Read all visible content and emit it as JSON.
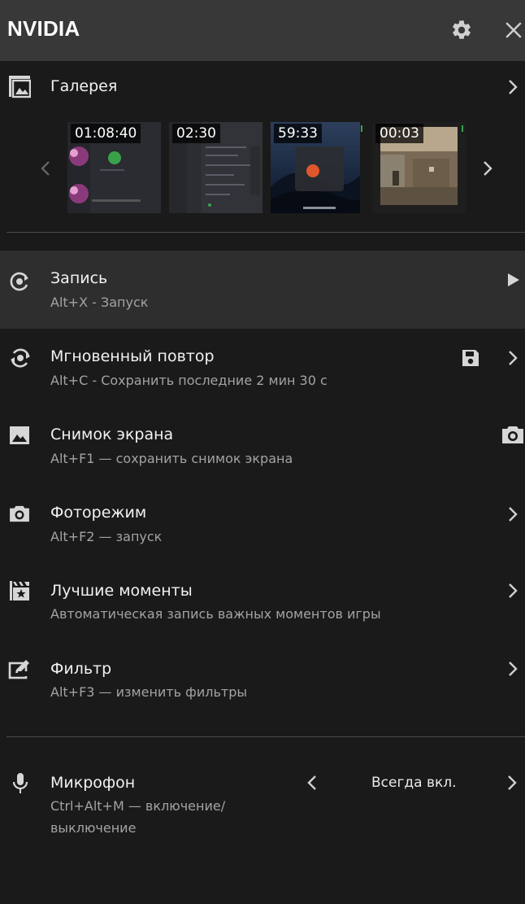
{
  "header": {
    "brand": "NVIDIA",
    "settings_icon": "gear-icon",
    "close_icon": "close-icon"
  },
  "gallery": {
    "title": "Галерея",
    "thumbnails": [
      {
        "duration": "01:08:40",
        "style": "discord-call"
      },
      {
        "duration": "02:30",
        "style": "dark-app"
      },
      {
        "duration": "59:33",
        "style": "mac-desktop"
      },
      {
        "duration": "00:03",
        "style": "game"
      }
    ]
  },
  "items": [
    {
      "key": "record",
      "title": "Запись",
      "subtitle": "Alt+X - Запуск",
      "icon": "record-icon",
      "action_icon": "play-icon",
      "active": true
    },
    {
      "key": "instant-replay",
      "title": "Мгновенный повтор",
      "subtitle": "Alt+C - Сохранить последние 2 мин 30 с",
      "icon": "instant-replay-icon",
      "action_icon": "save-icon"
    },
    {
      "key": "screenshot",
      "title": "Снимок экрана",
      "subtitle": "Alt+F1 — сохранить снимок экрана",
      "icon": "image-icon",
      "action_icon": "camera-icon"
    },
    {
      "key": "photo-mode",
      "title": "Фоторежим",
      "subtitle": "Alt+F2 — запуск",
      "icon": "camera-icon"
    },
    {
      "key": "highlights",
      "title": "Лучшие моменты",
      "subtitle": "Автоматическая запись важных моментов игры",
      "icon": "clapperboard-star-icon"
    },
    {
      "key": "filter",
      "title": "Фильтр",
      "subtitle": "Alt+F3 — изменить фильтры",
      "icon": "filter-edit-icon"
    }
  ],
  "microphone": {
    "title": "Микрофон",
    "subtitle_line1": "Ctrl+Alt+M — включение/",
    "subtitle_line2": "выключение",
    "value": "Всегда вкл.",
    "icon": "microphone-icon"
  }
}
